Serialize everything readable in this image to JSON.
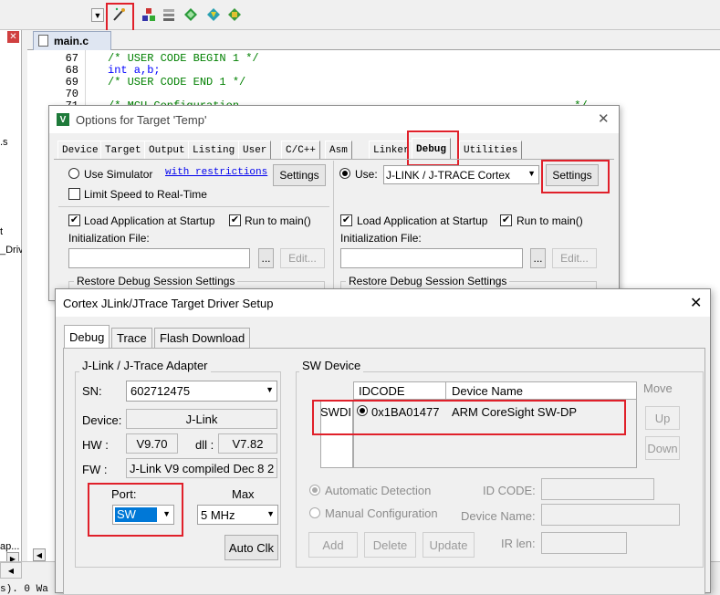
{
  "ide": {
    "editor_tab": "main.c",
    "lines": [
      {
        "num": "67",
        "text": "/* USER CODE BEGIN 1 */"
      },
      {
        "num": "68",
        "text": "int a,b;"
      },
      {
        "num": "69",
        "text": "/* USER CODE END 1 */"
      },
      {
        "num": "70",
        "text": ""
      },
      {
        "num": "71",
        "text": "/* MCU Configuration---------------------------------------------------*/"
      }
    ],
    "left_fragments": [
      ".s",
      "t",
      "_Driv"
    ],
    "bottom_left_text": "ap...",
    "status_text": "s). 0 Wa"
  },
  "options_dialog": {
    "title": "Options for Target 'Temp'",
    "tabs": [
      "Device",
      "Target",
      "Output",
      "Listing",
      "User",
      "C/C++",
      "Asm",
      "Linker",
      "Debug",
      "Utilities"
    ],
    "active_tab": "Debug",
    "left": {
      "use_simulator": "Use Simulator",
      "with_restrictions": "with restrictions",
      "settings": "Settings",
      "limit_speed": "Limit Speed to Real-Time",
      "load_app": "Load Application at Startup",
      "run_to_main": "Run to main()",
      "init_file": "Initialization File:",
      "browse": "...",
      "edit": "Edit...",
      "restore": "Restore Debug Session Settings"
    },
    "right": {
      "use": "Use:",
      "debugger": "J-LINK / J-TRACE Cortex",
      "settings": "Settings",
      "load_app": "Load Application at Startup",
      "run_to_main": "Run to main()",
      "init_file": "Initialization File:",
      "browse": "...",
      "edit": "Edit...",
      "restore": "Restore Debug Session Settings"
    }
  },
  "jlink_dialog": {
    "title": "Cortex JLink/JTrace Target Driver Setup",
    "tabs": [
      "Debug",
      "Trace",
      "Flash Download"
    ],
    "adapter": {
      "group": "J-Link / J-Trace Adapter",
      "sn_label": "SN:",
      "sn_value": "602712475",
      "device_label": "Device:",
      "device_value": "J-Link",
      "hw_label": "HW :",
      "hw_value": "V9.70",
      "dll_label": "dll :",
      "dll_value": "V7.82",
      "fw_label": "FW :",
      "fw_value": "J-Link V9 compiled Dec  8 2",
      "port_label": "Port:",
      "port_value": "SW",
      "max_label": "Max",
      "max_value": "5 MHz",
      "auto_clk": "Auto Clk"
    },
    "sw_device": {
      "group": "SW Device",
      "col_idcode": "IDCODE",
      "col_device": "Device Name",
      "row_label": "SWDI",
      "idcode": "0x1BA01477",
      "device_name": "ARM CoreSight SW-DP",
      "move": "Move",
      "up": "Up",
      "down": "Down",
      "auto_detect": "Automatic Detection",
      "manual_config": "Manual Configuration",
      "id_code": "ID CODE:",
      "device_name_label": "Device Name:",
      "ir_len": "IR len:",
      "add": "Add",
      "delete": "Delete",
      "update": "Update"
    }
  },
  "colors": {
    "highlight_red": "#e0202a",
    "selection_blue": "#0078d7"
  }
}
